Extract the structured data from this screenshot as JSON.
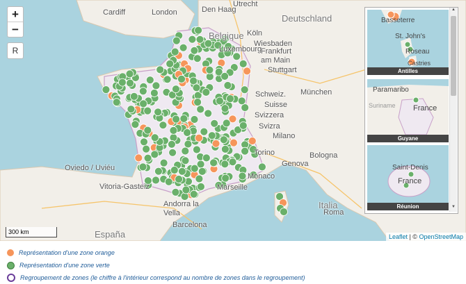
{
  "map": {
    "labels": [
      "Cardiff",
      "London",
      "Den Haag",
      "Utrecht",
      "Deutschland",
      "Belgique",
      "Köln",
      "Wiesbaden",
      "Frankfurt am Main",
      "Luxembourg",
      "Stuttgart",
      "München",
      "Schweiz.",
      "Suisse",
      "Svizzera",
      "Svizra",
      "Milano",
      "Torino",
      "Genova",
      "Bologna",
      "Monaco",
      "Marseille",
      "Oviedo / Uviéu",
      "Vitoria-Gasteiz",
      "Andorra la Vella",
      "Barcelona",
      "España",
      "Italia",
      "Roma"
    ],
    "markers_orange": 40,
    "markers_green": 300,
    "colors": {
      "orange": "#f6955b",
      "green": "#6ab06a",
      "group": "#6a3d9a",
      "sea": "#aad3df",
      "land": "#f2efe9"
    }
  },
  "controls": {
    "zoom_in": "+",
    "zoom_out": "−",
    "reset": "R"
  },
  "scale_label": "300 km",
  "attribution": {
    "leaflet": "Leaflet",
    "separator": " | © ",
    "osm": "OpenStreetMap"
  },
  "insets": [
    {
      "caption": "Antilles",
      "labels": [
        "Basseterre",
        "St. John's",
        "Roseau",
        "Castries"
      ]
    },
    {
      "caption": "Guyane",
      "labels": [
        "Paramaribo",
        "France",
        "Suriname"
      ]
    },
    {
      "caption": "Réunion",
      "labels": [
        "Saint-Denis",
        "France"
      ]
    }
  ],
  "legend": [
    {
      "label": "Représentation d'une zone orange",
      "color": "#f6955b"
    },
    {
      "label": "Représentation d'une zone verte",
      "color": "#6ab06a"
    },
    {
      "label": "Regroupement de zones (le chiffre à l'intérieur correspond au nombre de zones dans le regroupement)",
      "color": "#6a3d9a"
    }
  ]
}
